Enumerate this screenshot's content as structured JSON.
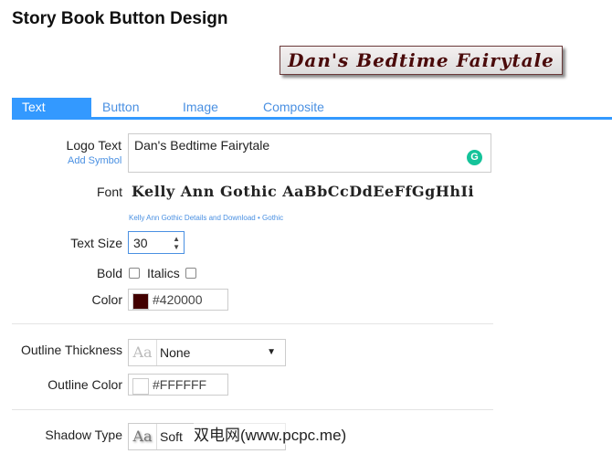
{
  "title": "Story Book Button Design",
  "logo_preview": "Dan's Bedtime Fairytale",
  "tabs": [
    "Text",
    "Button",
    "Image",
    "Composite"
  ],
  "form": {
    "logo_text_label": "Logo Text",
    "add_symbol": "Add Symbol",
    "logo_text_value": "Dan's Bedtime Fairytale",
    "font_label": "Font",
    "font_preview": "Kelly Ann Gothic AaBbCcDdEeFfGgHhIi",
    "font_link": "Kelly Ann Gothic Details and Download",
    "font_sep": "•",
    "font_category": "Gothic",
    "text_size_label": "Text Size",
    "text_size_value": "30",
    "bold_label": "Bold",
    "italics_label": "Italics",
    "color_label": "Color",
    "color_value": "#420000",
    "outline_thickness_label": "Outline Thickness",
    "outline_thickness_value": "None",
    "outline_color_label": "Outline Color",
    "outline_color_value": "#FFFFFF",
    "shadow_type_label": "Shadow Type",
    "shadow_type_value": "Soft",
    "aa": "Aa"
  },
  "watermark": "双电网(www.pcpc.me)",
  "colors": {
    "accent": "#3399ff",
    "text_color": "#420000",
    "outline_color": "#FFFFFF"
  }
}
